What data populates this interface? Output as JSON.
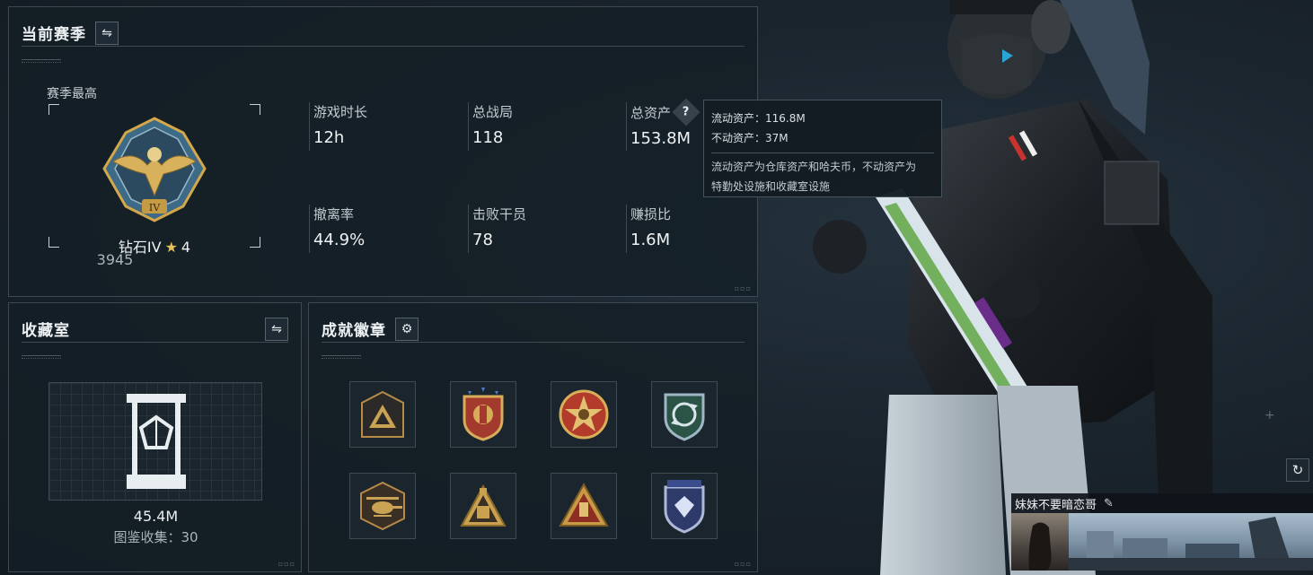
{
  "season": {
    "title": "当前赛季",
    "switch_icon": "swap-icon",
    "best_label": "赛季最高",
    "rank_name": "钻石IV",
    "rank_stars": "4",
    "rank_score": "3945",
    "stats": [
      {
        "label": "游戏时长",
        "value": "12h"
      },
      {
        "label": "总战局",
        "value": "118"
      },
      {
        "label": "总资产",
        "value": "153.8M"
      },
      {
        "label": "撤离率",
        "value": "44.9%"
      },
      {
        "label": "击败干员",
        "value": "78"
      },
      {
        "label": "赚损比",
        "value": "1.6M"
      }
    ]
  },
  "tooltip": {
    "liquid": "流动资产：116.8M",
    "fixed": "不动资产：37M",
    "desc1": "流动资产为仓库资产和哈夫币，不动资产为",
    "desc2": "特勤处设施和收藏室设施"
  },
  "collection": {
    "title": "收藏室",
    "value": "45.4M",
    "count": "图鉴收集：30"
  },
  "achievements": {
    "title": "成就徽章",
    "settings_icon": "gear-icon"
  },
  "player": {
    "name": "妹妹不要暗恋哥"
  },
  "colors": {
    "gold": "#d3a74a",
    "panel_bg": "#141e26",
    "border": "#3b4954"
  }
}
